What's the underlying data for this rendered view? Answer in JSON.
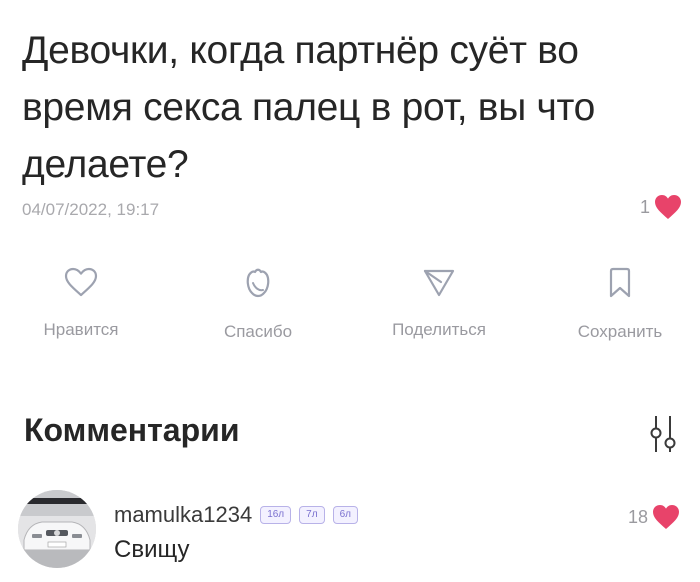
{
  "post": {
    "text": "Девочки, когда партнёр суёт во время секса палец в рот, вы что делаете?",
    "date": "04/07/2022, 19:17",
    "likes": "1",
    "heart_color": "#e8436a"
  },
  "actions": [
    {
      "label": "Нравится",
      "icon": "heart-outline-icon"
    },
    {
      "label": "Спасибо",
      "icon": "flower-icon"
    },
    {
      "label": "Поделиться",
      "icon": "share-arrow-icon"
    },
    {
      "label": "Сохранить",
      "icon": "bookmark-icon"
    }
  ],
  "comments_section": {
    "title": "Комментарии",
    "filter_icon": "sliders-icon"
  },
  "comment": {
    "author": "mamulka1234",
    "badges": [
      "16л",
      "7л",
      "6л"
    ],
    "text": "Свищу",
    "likes": "18"
  }
}
